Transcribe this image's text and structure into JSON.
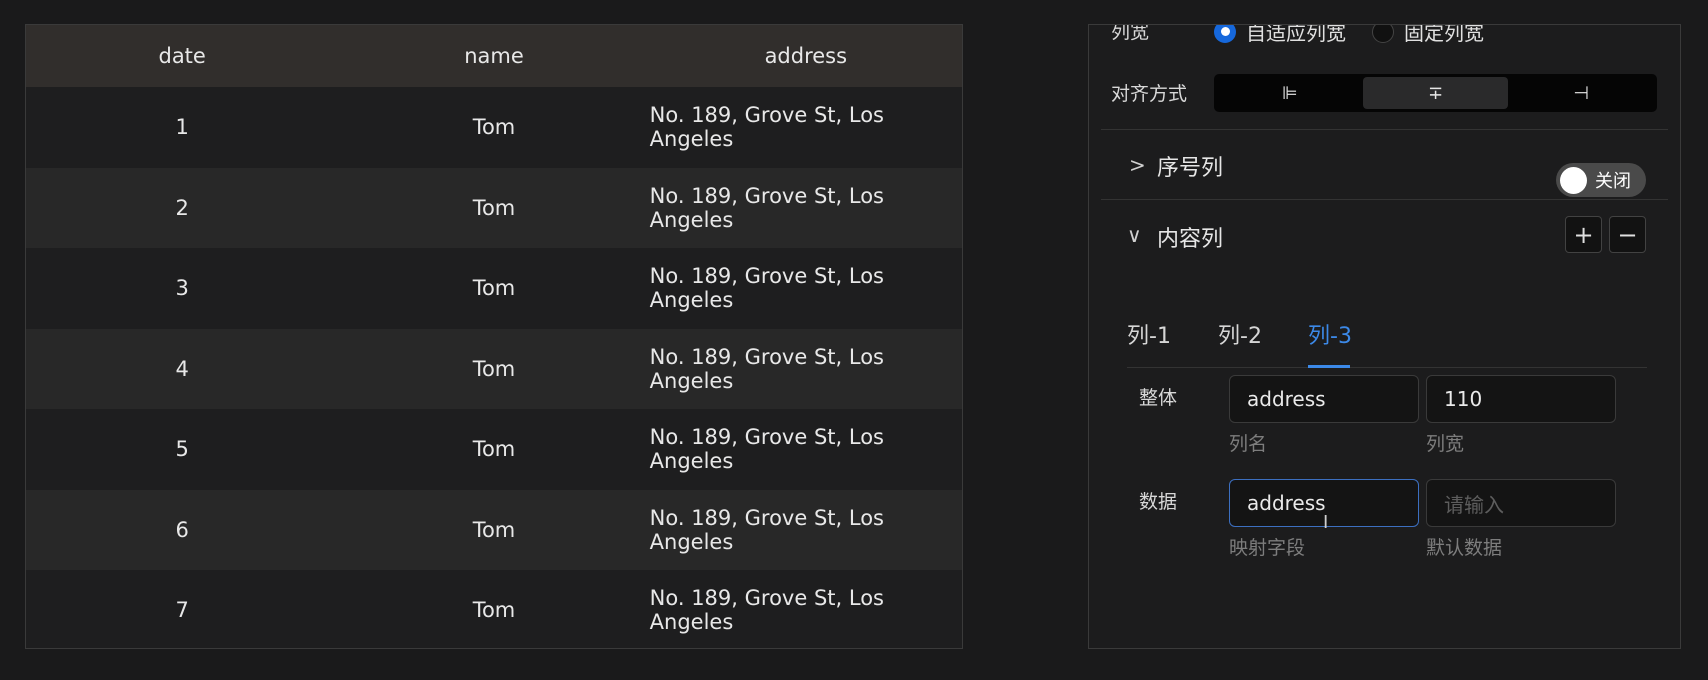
{
  "table": {
    "columns": [
      "date",
      "name",
      "address"
    ],
    "rows": [
      {
        "date": "1",
        "name": "Tom",
        "address": "No. 189, Grove St, Los Angeles"
      },
      {
        "date": "2",
        "name": "Tom",
        "address": "No. 189, Grove St, Los Angeles"
      },
      {
        "date": "3",
        "name": "Tom",
        "address": "No. 189, Grove St, Los Angeles"
      },
      {
        "date": "4",
        "name": "Tom",
        "address": "No. 189, Grove St, Los Angeles"
      },
      {
        "date": "5",
        "name": "Tom",
        "address": "No. 189, Grove St, Los Angeles"
      },
      {
        "date": "6",
        "name": "Tom",
        "address": "No. 189, Grove St, Los Angeles"
      },
      {
        "date": "7",
        "name": "Tom",
        "address": "No. 189, Grove St, Los Angeles"
      }
    ]
  },
  "config": {
    "column_width": {
      "label": "列宽",
      "options": [
        {
          "label": "自适应列宽",
          "selected": true
        },
        {
          "label": "固定列宽",
          "selected": false
        }
      ]
    },
    "alignment": {
      "label": "对齐方式",
      "options": [
        "⊫",
        "∓",
        "⊣"
      ],
      "selected_index": 1
    },
    "index_column": {
      "title": "序号列",
      "chevron": ">",
      "switch_label": "关闭",
      "switch_on": false
    },
    "content_column": {
      "title": "内容列",
      "chevron": "∨",
      "add_label": "+",
      "remove_label": "−",
      "tabs": [
        "列-1",
        "列-2",
        "列-3"
      ],
      "active_tab": 2,
      "overall": {
        "label": "整体",
        "name_value": "address",
        "name_hint": "列名",
        "width_value": "110",
        "width_hint": "列宽"
      },
      "data": {
        "label": "数据",
        "field_value": "address",
        "field_hint": "映射字段",
        "default_placeholder": "请输入",
        "default_hint": "默认数据"
      }
    }
  },
  "colors": {
    "accent": "#3c89e8",
    "radio_selected": "#1668dc",
    "header_bg": "#312e2c"
  }
}
